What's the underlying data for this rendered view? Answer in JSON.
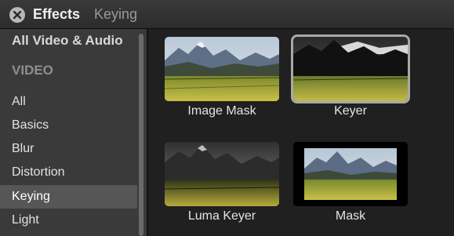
{
  "header": {
    "title": "Effects",
    "breadcrumb": "Keying"
  },
  "sidebar": {
    "items": [
      {
        "label": "All Video & Audio"
      },
      {
        "label": "VIDEO"
      },
      {
        "label": "All"
      },
      {
        "label": "Basics"
      },
      {
        "label": "Blur"
      },
      {
        "label": "Distortion"
      },
      {
        "label": "Keying"
      },
      {
        "label": "Light"
      }
    ],
    "selected": "Keying"
  },
  "effects": [
    {
      "label": "Image Mask"
    },
    {
      "label": "Keyer"
    },
    {
      "label": "Luma Keyer"
    },
    {
      "label": "Mask"
    }
  ]
}
